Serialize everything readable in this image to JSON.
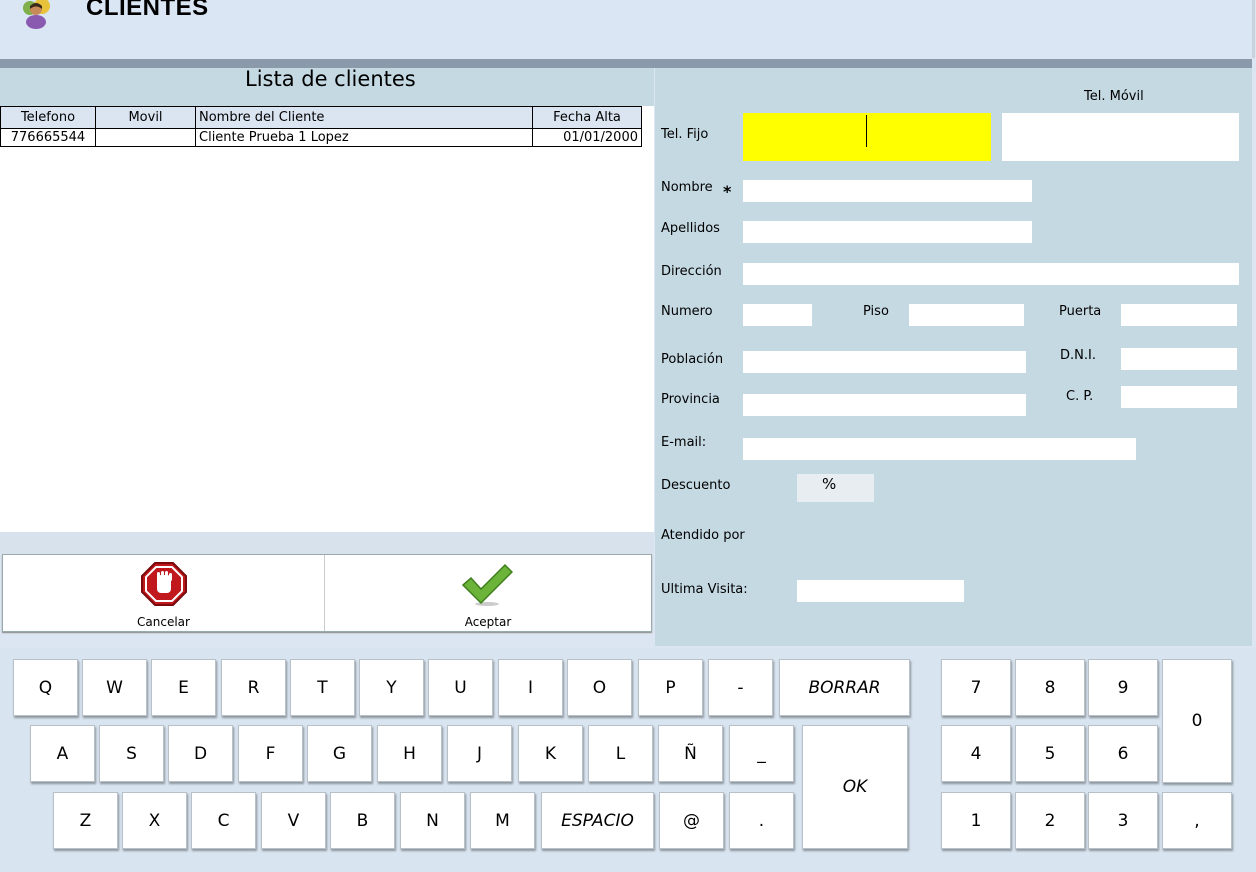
{
  "header": {
    "title": "CLIENTES",
    "logo_icon": "clients-logo-icon"
  },
  "list": {
    "title": "Lista de clientes",
    "columns": [
      "Telefono",
      "Movil",
      "Nombre del Cliente",
      "Fecha Alta"
    ],
    "rows": [
      {
        "telefono": "776665544",
        "movil": "",
        "nombre": "Cliente Prueba 1 Lopez",
        "fecha": "01/01/2000"
      }
    ]
  },
  "actions": {
    "cancel_label": "Cancelar",
    "cancel_icon": "stop-hand-icon",
    "accept_label": "Aceptar",
    "accept_icon": "checkmark-icon"
  },
  "form": {
    "tel_movil_label": "Tel. Móvil",
    "tel_fijo_label": "Tel. Fijo",
    "tel_fijo_value": "",
    "tel_movil_value": "",
    "nombre_label": "Nombre",
    "required_mark": "*",
    "apellidos_label": "Apellidos",
    "direccion_label": "Dirección",
    "numero_label": "Numero",
    "piso_label": "Piso",
    "puerta_label": "Puerta",
    "poblacion_label": "Población",
    "dni_label": "D.N.I.",
    "provincia_label": "Provincia",
    "cp_label": "C. P.",
    "email_label": "E-mail:",
    "descuento_label": "Descuento",
    "descuento_suffix": "%",
    "atendido_label": "Atendido por",
    "ultima_visita_label": "Ultima Visita:",
    "active_field_color": "#ffff00"
  },
  "keyboard": {
    "row1": [
      "Q",
      "W",
      "E",
      "R",
      "T",
      "Y",
      "U",
      "I",
      "O",
      "P",
      "-"
    ],
    "borrar": "BORRAR",
    "row2": [
      "A",
      "S",
      "D",
      "F",
      "G",
      "H",
      "J",
      "K",
      "L",
      "Ñ",
      "_"
    ],
    "ok": "OK",
    "row3": [
      "Z",
      "X",
      "C",
      "V",
      "B",
      "N",
      "M"
    ],
    "espacio": "ESPACIO",
    "row3_end": [
      "@",
      "."
    ],
    "numpad": [
      "7",
      "8",
      "9",
      "4",
      "5",
      "6",
      "1",
      "2",
      "3"
    ],
    "zero": "0",
    "comma": ","
  }
}
